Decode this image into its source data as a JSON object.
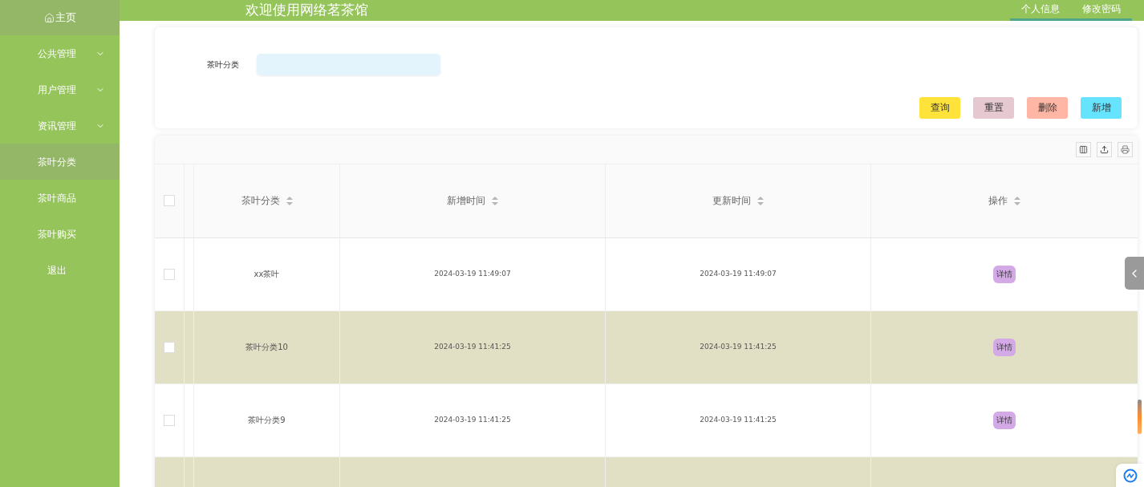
{
  "sidebar": {
    "home": "主页",
    "items": [
      {
        "label": "公共管理",
        "kind": "group",
        "selected": false
      },
      {
        "label": "用户管理",
        "kind": "group",
        "selected": false
      },
      {
        "label": "资讯管理",
        "kind": "group",
        "selected": false
      },
      {
        "label": "茶叶分类",
        "kind": "link",
        "selected": true
      },
      {
        "label": "茶叶商品",
        "kind": "link",
        "selected": false
      },
      {
        "label": "茶叶购买",
        "kind": "link",
        "selected": false
      },
      {
        "label": "退出",
        "kind": "link",
        "selected": false
      }
    ]
  },
  "header": {
    "title": "欢迎使用网络茗茶馆",
    "links": [
      "个人信息",
      "修改密码"
    ]
  },
  "search": {
    "label": "茶叶分类"
  },
  "actions": [
    {
      "label": "查询",
      "color": "#ffe33a"
    },
    {
      "label": "重置",
      "color": "#e5c8d0"
    },
    {
      "label": "删除",
      "color": "#ffb6a4"
    },
    {
      "label": "新增",
      "color": "#66e3ff"
    }
  ],
  "table": {
    "columns": [
      "茶叶分类",
      "新增时间",
      "更新时间",
      "操作"
    ],
    "all_checked": false,
    "rows": [
      {
        "checked": false,
        "category": "xx茶叶",
        "created": "2024-03-19 11:49:07",
        "updated": "2024-03-19 11:49:07",
        "action": "详情"
      },
      {
        "checked": false,
        "category": "茶叶分类10",
        "created": "2024-03-19 11:41:25",
        "updated": "2024-03-19 11:41:25",
        "action": "详情"
      },
      {
        "checked": false,
        "category": "茶叶分类9",
        "created": "2024-03-19 11:41:25",
        "updated": "2024-03-19 11:41:25",
        "action": "详情"
      }
    ]
  }
}
